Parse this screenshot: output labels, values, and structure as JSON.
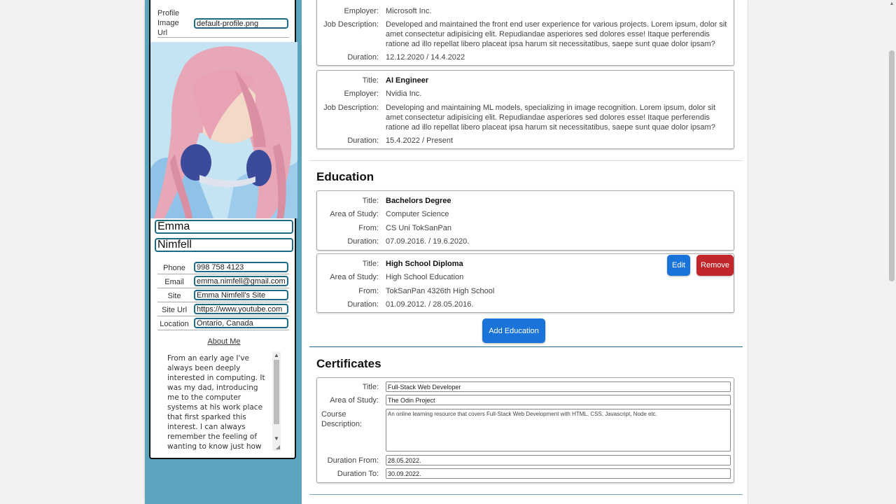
{
  "sidebar": {
    "image_url_label": "Profile Image Url",
    "image_url_value": "default-profile.png",
    "first_name": "Emma",
    "last_name": "Nimfell",
    "fields": [
      {
        "label": "Phone",
        "value": "998 758 4123"
      },
      {
        "label": "Email",
        "value": "emma.nimfell@gmail.com"
      },
      {
        "label": "Site",
        "value": "Emma Nimfell's Site"
      },
      {
        "label": "Site Url",
        "value": "https://www.youtube.com"
      },
      {
        "label": "Location",
        "value": "Ontario, Canada"
      }
    ],
    "about_title": "About Me",
    "about_text": "From an early age I've always been deeply interested in computing. It was my dad, introducing me to the computer systems at his work place that first sparked this interest. I can always remember the feeling of wanting to know just how computers worked, why they"
  },
  "experience": {
    "entries": [
      {
        "employer_label": "Employer:",
        "employer": "Microsoft Inc.",
        "desc_label": "Job Description:",
        "desc": "Developed and maintained the front end user experience for various projects. Lorem ipsum, dolor sit amet consectetur adipisicing elit. Repudiandae asperiores sed dolores esse! Itaque perferendis ratione ad illo repellat libero placeat ipsa harum sit necessitatibus, saepe sunt quae dolor ipsam?",
        "duration_label": "Duration:",
        "duration": "12.12.2020 / 14.4.2022"
      },
      {
        "title_label": "Title:",
        "title": "AI Engineer",
        "employer_label": "Employer:",
        "employer": "Nvidia Inc.",
        "desc_label": "Job Description:",
        "desc": "Developing and maintaining ML models, specializing in image recognition. Lorem ipsum, dolor sit amet consectetur adipisicing elit. Repudiandae asperiores sed dolores esse! Itaque perferendis ratione ad illo repellat libero placeat ipsa harum sit necessitatibus, saepe sunt quae dolor ipsam?",
        "duration_label": "Duration:",
        "duration": "15.4.2022 / Present"
      }
    ]
  },
  "education": {
    "heading": "Education",
    "entries": [
      {
        "title_label": "Title:",
        "title": "Bachelors Degree",
        "area_label": "Area of Study:",
        "area": "Computer Science",
        "from_label": "From:",
        "from": "CS Uni TokSanPan",
        "duration_label": "Duration:",
        "duration": "07.09.2016. / 19.6.2020."
      },
      {
        "title_label": "Title:",
        "title": "High School Diploma",
        "area_label": "Area of Study:",
        "area": "High School Education",
        "from_label": "From:",
        "from": "TokSanPan 4326th High School",
        "duration_label": "Duration:",
        "duration": "01.09.2012. / 28.05.2016."
      }
    ],
    "edit_label": "Edit",
    "remove_label": "Remove",
    "add_label": "Add Education"
  },
  "certificates": {
    "heading": "Certificates",
    "title_label": "Title:",
    "title": "Full-Stack Web Developer",
    "area_label": "Area of Study:",
    "area": "The Odin Project",
    "desc_label": "Course Description:",
    "desc": "An online learning resource that covers Full-Stack Web Development with HTML, CSS, Javascript, Node etc.",
    "from_label": "Duration From:",
    "from": "28.05.2022.",
    "to_label": "Duration To:",
    "to": "30.09.2022."
  },
  "colors": {
    "sidebar": "#5ba6be",
    "input_border": "#1c6a88",
    "primary": "#1a73d9",
    "danger": "#c0262a"
  }
}
